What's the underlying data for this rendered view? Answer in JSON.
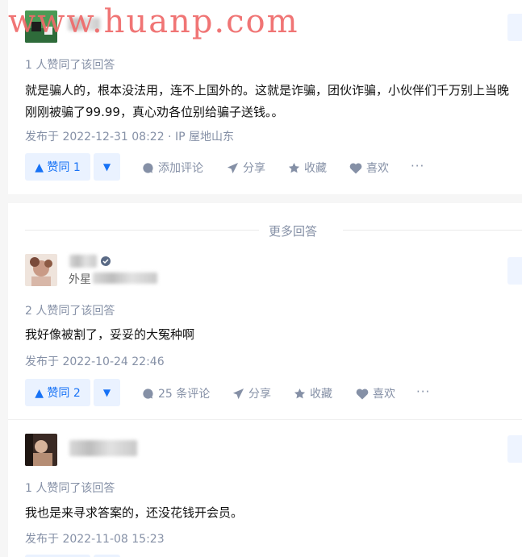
{
  "watermark": "www.huanp.com",
  "top_answer": {
    "votes_text": "1 人赞同了该回答",
    "content": "就是骗人的，根本没法用，连不上国外的。这就是诈骗，团伙诈骗，小伙伴们千万别上当晚刚刚被骗了99.99，真心劝各位别给骗子送钱。。",
    "posted": "发布于 2022-12-31 08:22 · IP 屋地山东",
    "vote_label": "▲ 赞同 1",
    "comment_label": "添加评论",
    "share_label": "分享",
    "collect_label": "收藏",
    "like_label": "喜欢"
  },
  "more_answers_title": "更多回答",
  "answers": [
    {
      "author_sub": "外星",
      "votes_text": "2 人赞同了该回答",
      "content": "我好像被割了，妥妥的大冤种啊",
      "posted": "发布于 2022-10-24 22:46",
      "vote_label": "▲ 赞同 2",
      "comment_label": "25 条评论",
      "share_label": "分享",
      "collect_label": "收藏",
      "like_label": "喜欢"
    },
    {
      "votes_text": "1 人赞同了该回答",
      "content": "我也是来寻求答案的，还没花钱开会员。",
      "posted": "发布于 2022-11-08 15:23"
    }
  ],
  "icons": {
    "vote_down": "▼",
    "more": "···"
  },
  "colors": {
    "accent": "#1772f6",
    "accent_bg": "#eaf2ff",
    "muted": "#8590a6",
    "watermark": "#ef6a6a"
  }
}
